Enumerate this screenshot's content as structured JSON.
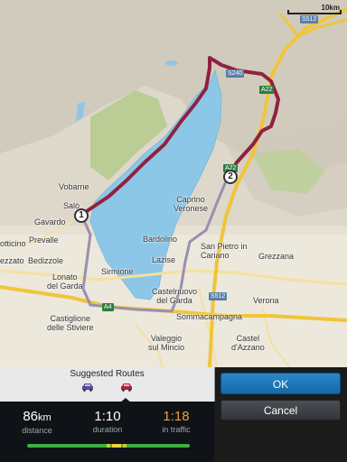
{
  "map": {
    "scale_label": "10km",
    "colors": {
      "lake": "#8dc7e8",
      "route_selected": "#8f2240",
      "route_alt": "#9a8fb0",
      "forest": "#b3c98c",
      "road_major": "#f0c53a",
      "road_minor": "#f5e0a0"
    },
    "places": {
      "vobarne": "Vobarne",
      "salo": "Salò",
      "gavardo": "Gavardo",
      "prevalle": "Prevalle",
      "botticino": "otticino",
      "bedizzole": "Bedizzole",
      "rezzato": "ezzato",
      "lonato": "Lonato\ndel Garda",
      "sirmione": "Sirmione",
      "castiglione": "Castiglione\ndelle Stiviere",
      "caprino": "Caprino\nVeronese",
      "bardolino": "Bardolino",
      "lazise": "Lazise",
      "san_pietro": "San Pietro in\nCariano",
      "grezzana": "Grezzana",
      "castelnuovo": "Castelnuovo\ndel Garda",
      "verona": "Verona",
      "sommacampagna": "Sommacampagna",
      "valeggio": "Valeggio\nsul Mincio",
      "castel_dazzano": "Castel\nd'Azzano"
    },
    "shields": {
      "s512_top": "S512",
      "s240": "S240",
      "a22_top": "A22",
      "a22_mid": "A22",
      "a4": "A4",
      "s512_bottom": "S512"
    },
    "waypoints": {
      "wp1": "1",
      "wp2": "2"
    }
  },
  "routes": {
    "title": "Suggested Routes",
    "route_icons": [
      "car-icon",
      "car-icon"
    ],
    "selected_index": 1,
    "distance_value": "86",
    "distance_unit": "km",
    "distance_label": "distance",
    "duration_value": "1:10",
    "duration_label": "duration",
    "traffic_value": "1:18",
    "traffic_label": "in traffic",
    "traffic_color": "#f0a030"
  },
  "actions": {
    "ok_label": "OK",
    "cancel_label": "Cancel",
    "ok_color": "#1a78bb"
  }
}
